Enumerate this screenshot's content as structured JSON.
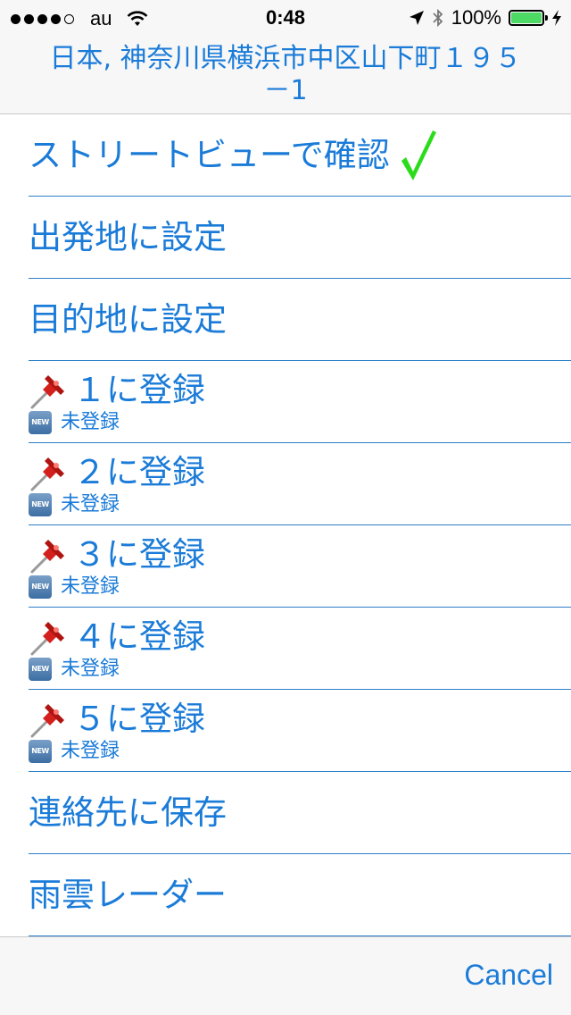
{
  "status": {
    "carrier": "au",
    "time": "0:48",
    "battery": "100%",
    "signal_bars_filled": 4,
    "signal_bars_total": 5
  },
  "header": {
    "line1": "日本, 神奈川県横浜市中区山下町１９５",
    "line2": "－1"
  },
  "menu": {
    "street_view": "ストリートビューで確認",
    "departure": "出発地に設定",
    "destination": "目的地に設定",
    "slots": [
      {
        "label": "１に登録",
        "status": "未登録",
        "badge": "NEW"
      },
      {
        "label": "２に登録",
        "status": "未登録",
        "badge": "NEW"
      },
      {
        "label": "３に登録",
        "status": "未登録",
        "badge": "NEW"
      },
      {
        "label": "４に登録",
        "status": "未登録",
        "badge": "NEW"
      },
      {
        "label": "５に登録",
        "status": "未登録",
        "badge": "NEW"
      }
    ],
    "save_contact": "連絡先に保存",
    "rain_radar": "雨雲レーダー"
  },
  "footer": {
    "cancel_label": "Cancel"
  },
  "icons": {
    "check": "check-mark-icon",
    "pin": "pushpin-icon",
    "new": "new-badge-icon"
  },
  "colors": {
    "accent": "#1a7bd8",
    "check": "#2bdc1b",
    "battery": "#4cd964"
  }
}
